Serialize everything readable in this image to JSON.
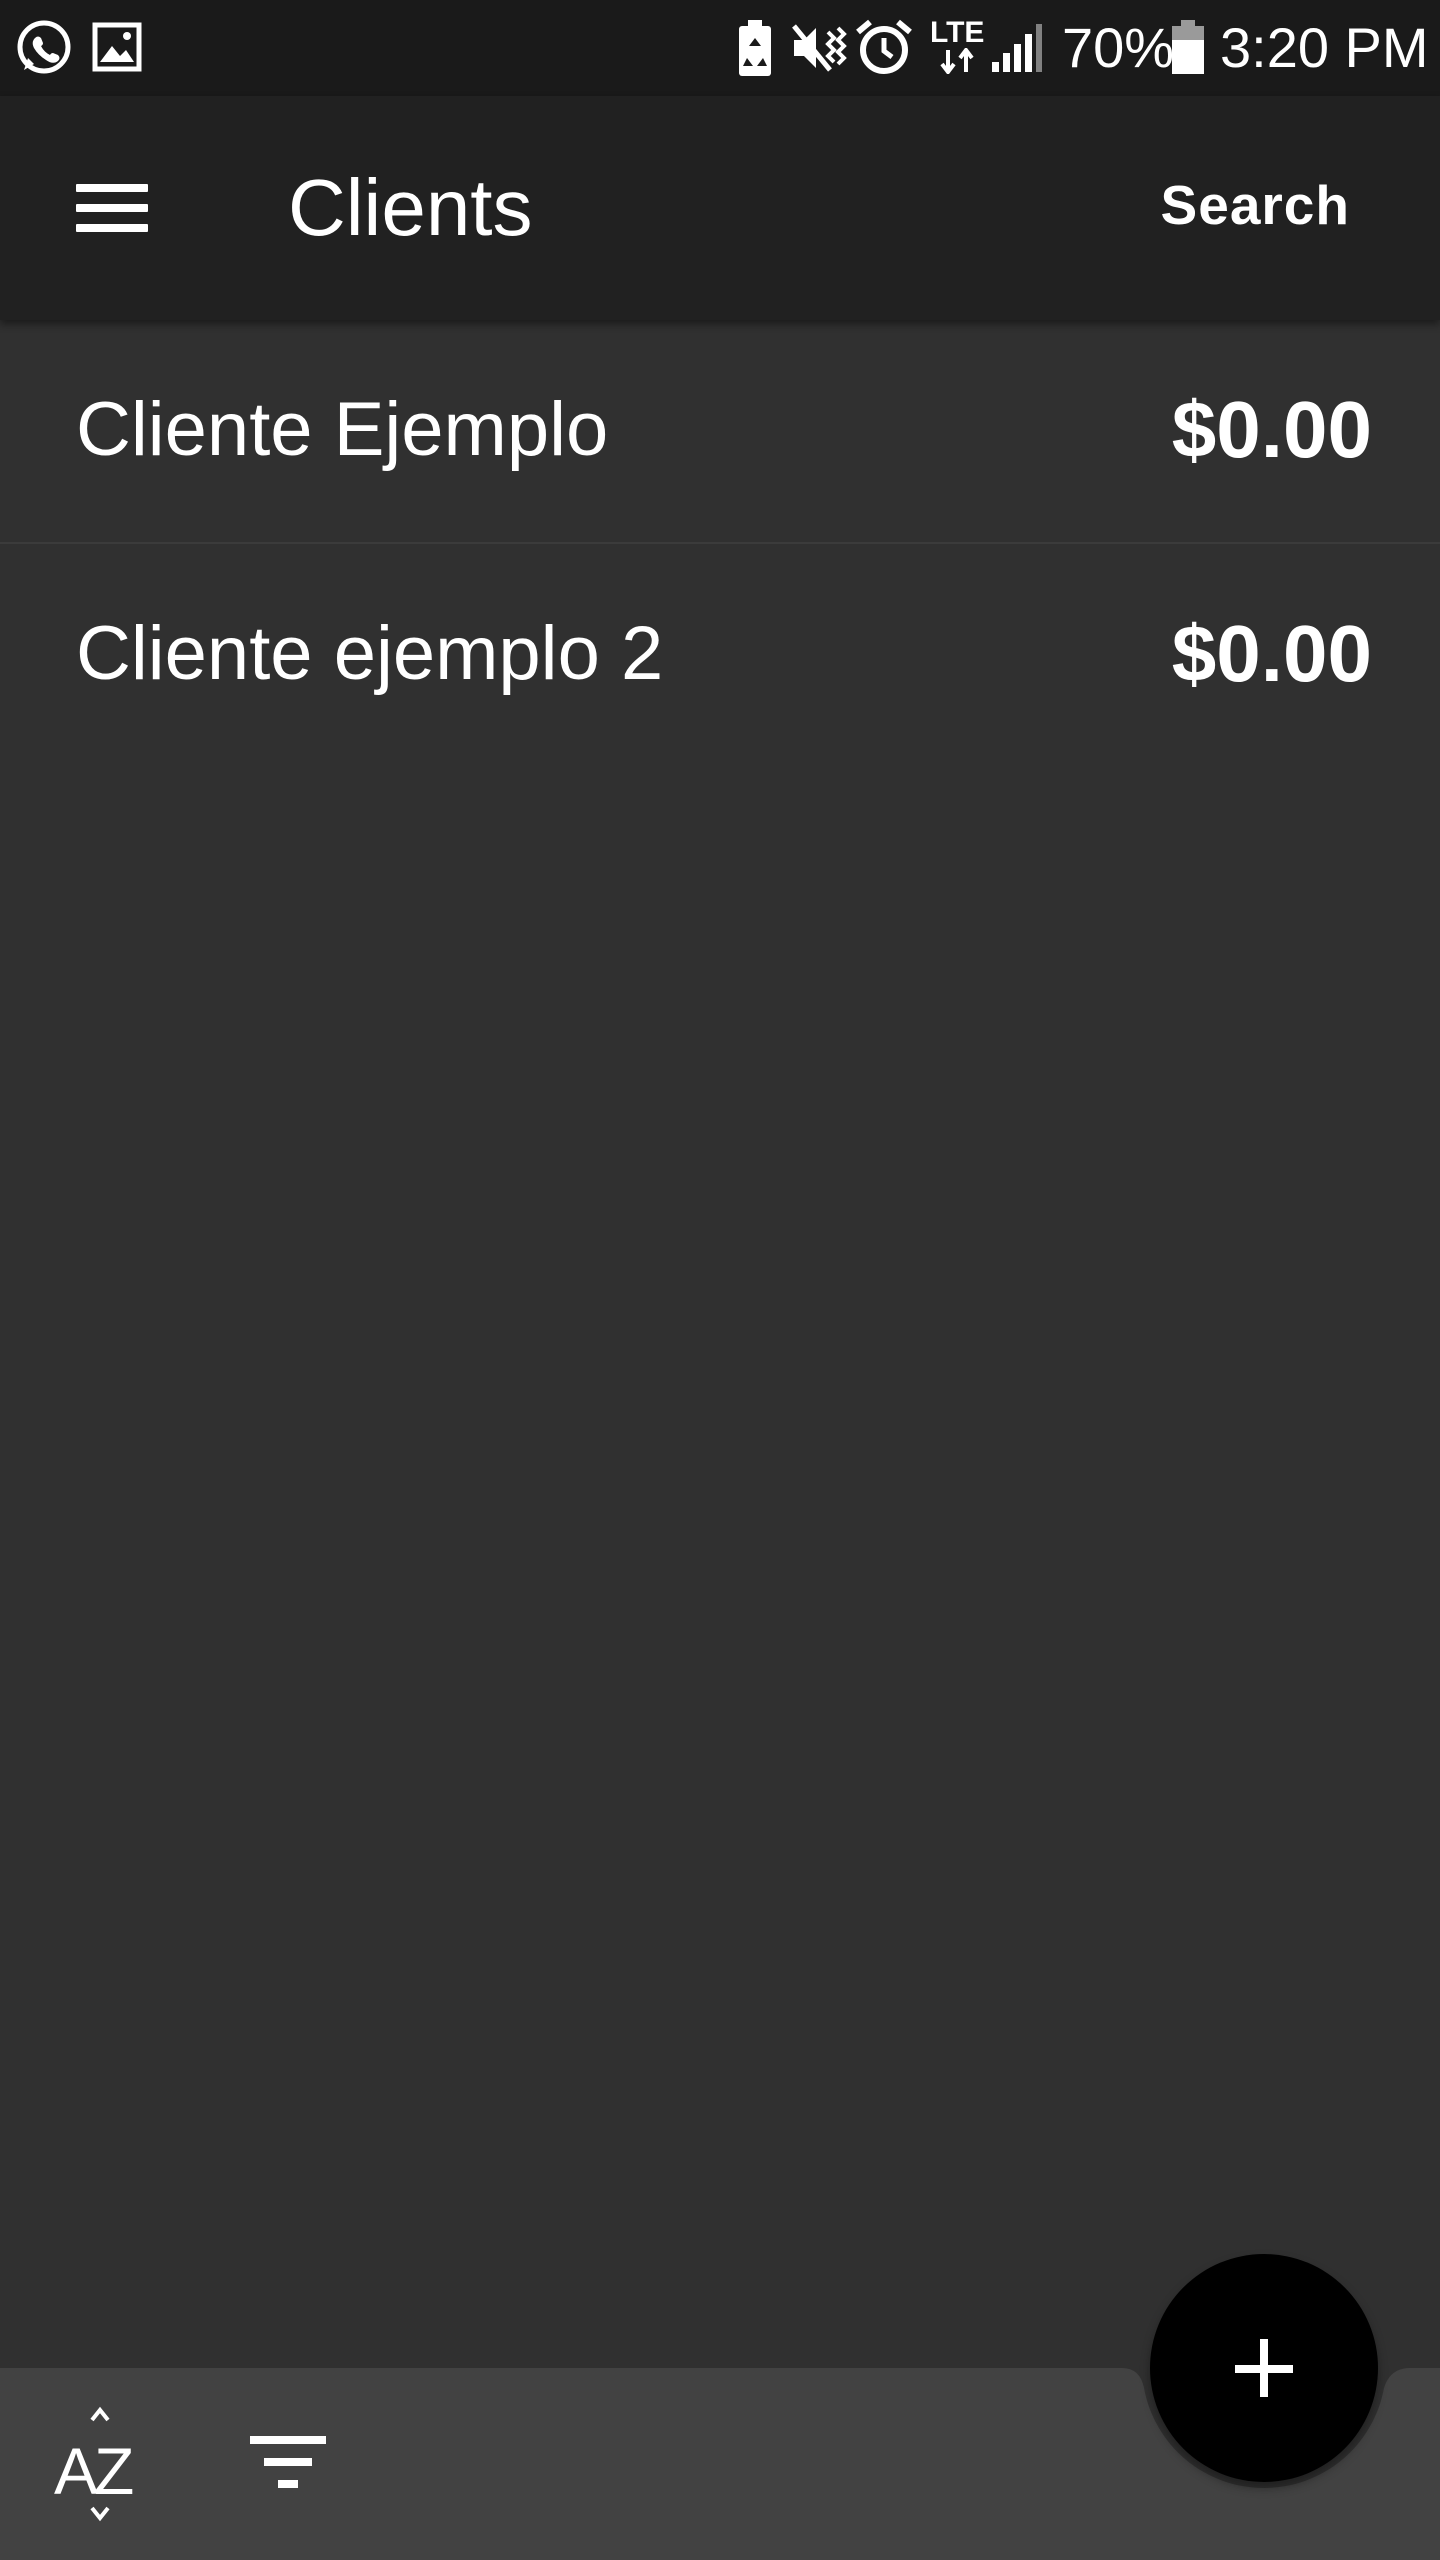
{
  "status_bar": {
    "left_icons": [
      "whatsapp-icon",
      "image-icon"
    ],
    "right_icons": [
      "battery-saver-icon",
      "vibrate-mute-icon",
      "alarm-icon",
      "lte-icon",
      "signal-icon",
      "battery-icon"
    ],
    "network": "LTE",
    "battery_percent": "70%",
    "time": "3:20 PM"
  },
  "app_bar": {
    "title": "Clients",
    "menu_icon": "hamburger-menu-icon",
    "search_label": "Search"
  },
  "clients": [
    {
      "name": "Cliente Ejemplo",
      "balance": "$0.00"
    },
    {
      "name": "Cliente ejemplo 2",
      "balance": "$0.00"
    }
  ],
  "bottom_bar": {
    "sort_icon": "sort-az-icon",
    "sort_label": "AZ",
    "filter_icon": "filter-icon"
  },
  "fab": {
    "icon": "add-icon"
  },
  "colors": {
    "status_bar": "#1a1a1a",
    "app_bar": "#212121",
    "background": "#303030",
    "bottom_bar": "#424242",
    "fab": "#000000",
    "text": "#ffffff"
  }
}
